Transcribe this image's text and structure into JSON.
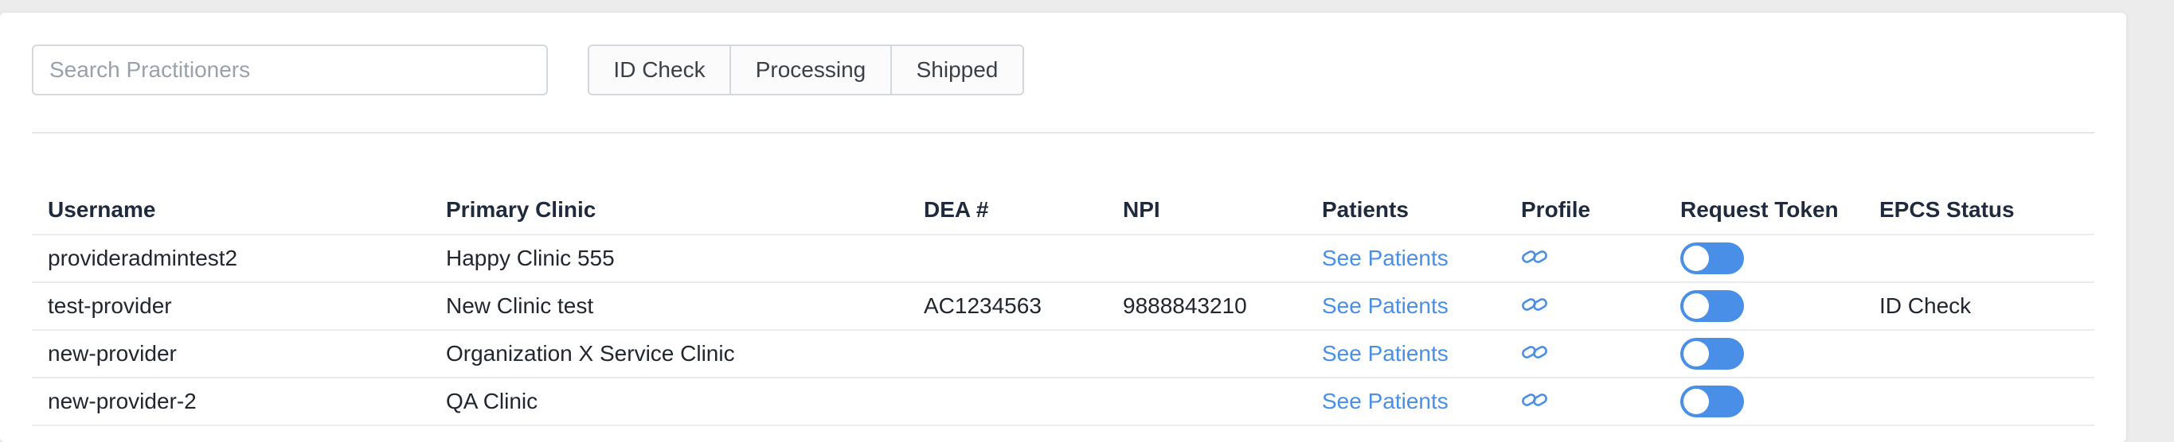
{
  "search": {
    "placeholder": "Search Practitioners",
    "value": ""
  },
  "filters": [
    "ID Check",
    "Processing",
    "Shipped"
  ],
  "table": {
    "columns": [
      "Username",
      "Primary Clinic",
      "DEA #",
      "NPI",
      "Patients",
      "Profile",
      "Request Token",
      "EPCS Status"
    ],
    "rows": [
      {
        "username": "provideradmintest2",
        "clinic": "Happy Clinic 555",
        "dea": "",
        "npi": "",
        "patients": "See Patients",
        "profile_icon": "link-icon",
        "token_enabled": true,
        "epcs": ""
      },
      {
        "username": "test-provider",
        "clinic": "New Clinic test",
        "dea": "AC1234563",
        "npi": "9888843210",
        "patients": "See Patients",
        "profile_icon": "link-icon",
        "token_enabled": true,
        "epcs": "ID Check"
      },
      {
        "username": "new-provider",
        "clinic": "Organization X Service Clinic",
        "dea": "",
        "npi": "",
        "patients": "See Patients",
        "profile_icon": "link-icon",
        "token_enabled": true,
        "epcs": ""
      },
      {
        "username": "new-provider-2",
        "clinic": "QA Clinic",
        "dea": "",
        "npi": "",
        "patients": "See Patients",
        "profile_icon": "link-icon",
        "token_enabled": true,
        "epcs": ""
      }
    ]
  },
  "colors": {
    "accent": "#4a8fe7",
    "border": "#d3d7de",
    "text": "#22262e"
  }
}
